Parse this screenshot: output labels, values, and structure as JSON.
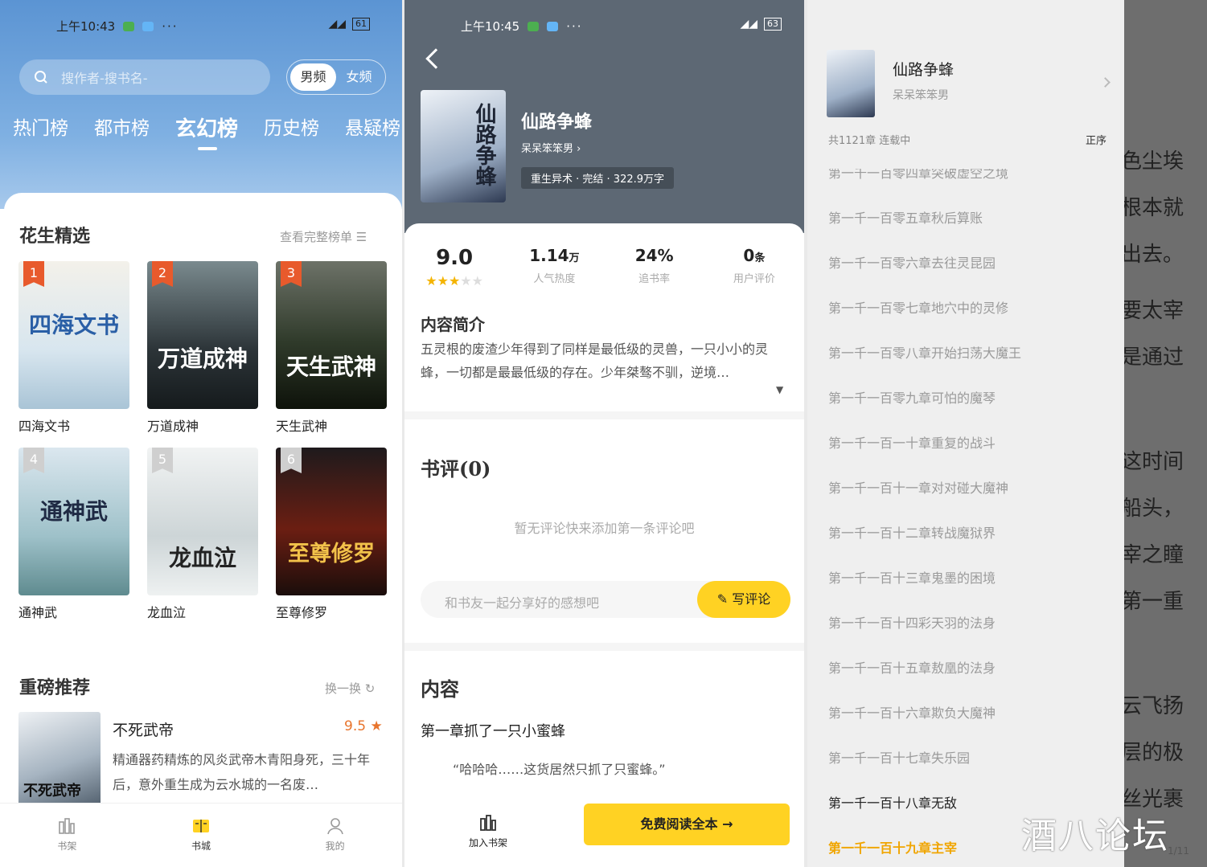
{
  "screen1": {
    "status_time": "上午10:43",
    "battery": "61",
    "search_placeholder": "搜作者-搜书名-",
    "gender": [
      "男频",
      "女频"
    ],
    "rank_tabs": [
      "热门榜",
      "都市榜",
      "玄幻榜",
      "历史榜",
      "悬疑榜"
    ],
    "featured": {
      "title": "花生精选",
      "link": "查看完整榜单",
      "books": [
        {
          "rank": "1",
          "name": "四海文书",
          "cover_text": "四海文书"
        },
        {
          "rank": "2",
          "name": "万道成神",
          "cover_text": "万道成神"
        },
        {
          "rank": "3",
          "name": "天生武神",
          "cover_text": "天生武神"
        },
        {
          "rank": "4",
          "name": "通神武",
          "cover_text": "通神武"
        },
        {
          "rank": "5",
          "name": "龙血泣",
          "cover_text": "龙血泣"
        },
        {
          "rank": "6",
          "name": "至尊修罗",
          "cover_text": "至尊修罗"
        }
      ]
    },
    "recommend": {
      "title": "重磅推荐",
      "link": "换一换",
      "book_name": "不死武帝",
      "score": "9.5",
      "desc": "精通器药精炼的风炎武帝木青阳身死，三十年后，意外重生成为云水城的一名废…",
      "cover_text": "不死武帝"
    },
    "tabbar": [
      "书架",
      "书城",
      "我的"
    ]
  },
  "screen2": {
    "status_time": "上午10:45",
    "battery": "63",
    "book_title": "仙路争蜂",
    "author": "呆呆笨笨男",
    "tags": "重生异术 · 完结 · 322.9万字",
    "stats": [
      {
        "value": "9.0",
        "label": ""
      },
      {
        "value": "1.14",
        "unit": "万",
        "label": "人气热度"
      },
      {
        "value": "24%",
        "label": "追书率"
      },
      {
        "value": "0",
        "unit": "条",
        "label": "用户评价"
      }
    ],
    "rating_stars": 3,
    "intro_title": "内容简介",
    "intro": "五灵根的废渣少年得到了同样是最低级的灵兽，一只小小的灵蜂，一切都是最最低级的存在。少年桀骜不驯，逆境…",
    "review_title": "书评(0)",
    "review_empty": "暂无评论快来添加第一条评论吧",
    "comment_placeholder": "和书友一起分享好的感想吧",
    "comment_button": "写评论",
    "content_title": "内容",
    "first_chapter": "第一章抓了一只小蜜蜂",
    "quote": "“哈哈哈……这货居然只抓了只蜜蜂。”",
    "add_shelf": "加入书架",
    "read_button": "免费阅读全本 →"
  },
  "screen3": {
    "book_title": "仙路争蜂",
    "author": "呆呆笨笨男",
    "meta": "共1121章 连载中",
    "order": "正序",
    "chapters": [
      "第一千一百零四章突破虚空之境",
      "第一千一百零五章秋后算账",
      "第一千一百零六章去往灵昆园",
      "第一千一百零七章地穴中的灵修",
      "第一千一百零八章开始扫荡大魔王",
      "第一千一百零九章可怕的魔琴",
      "第一千一百一十章重复的战斗",
      "第一千一百十一章对对碰大魔神",
      "第一千一百十二章转战魔狱界",
      "第一千一百十三章鬼墨的困境",
      "第一千一百十四彩天羽的法身",
      "第一千一百十五章敖凰的法身",
      "第一千一百十六章欺负大魔神",
      "第一千一百十七章失乐园",
      "第一千一百十八章无敌",
      "第一千一百十九章主宰"
    ],
    "reader_lines": [
      "色尘埃",
      "根本就",
      "出去。",
      "要太宰",
      "是通过",
      "这时间",
      "船头，",
      "宰之瞳",
      "第一重",
      "云飞扬",
      "层的极",
      "丝光裹"
    ],
    "page": "1/11"
  },
  "watermark": "酒八论坛",
  "colors": {
    "accent": "#ffd223",
    "sky": "#5b94d3",
    "current_chapter": "#f0a500",
    "rank_badge": "#e85a2c"
  }
}
